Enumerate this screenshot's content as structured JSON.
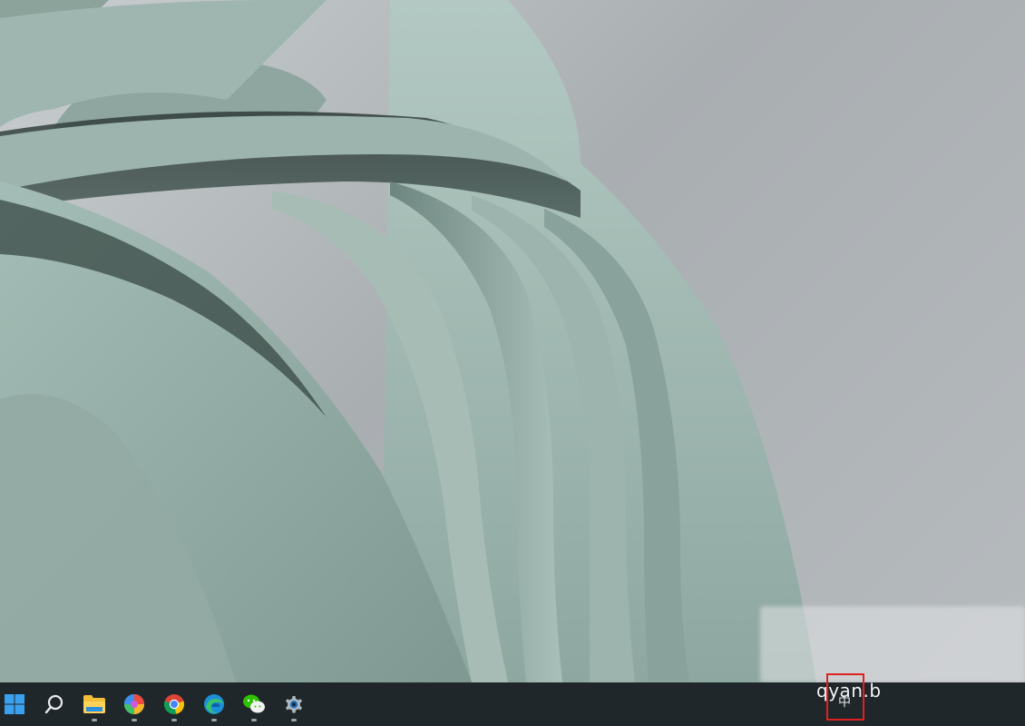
{
  "taskbar": {
    "items": [
      {
        "name": "start",
        "icon": "windows-icon",
        "running": false
      },
      {
        "name": "search",
        "icon": "search-icon",
        "running": false
      },
      {
        "name": "file-explorer",
        "icon": "folder-icon",
        "running": true
      },
      {
        "name": "color-app",
        "icon": "pinwheel-icon",
        "running": true
      },
      {
        "name": "chrome",
        "icon": "chrome-icon",
        "running": true
      },
      {
        "name": "edge",
        "icon": "edge-icon",
        "running": true
      },
      {
        "name": "wechat",
        "icon": "wechat-icon",
        "running": true
      },
      {
        "name": "settings",
        "icon": "gear-icon",
        "running": true
      }
    ]
  },
  "tray": {
    "chevron": "^",
    "ime_label": "中",
    "highlight_color": "#e02020"
  },
  "watermark": {
    "text": "qyan.b"
  }
}
